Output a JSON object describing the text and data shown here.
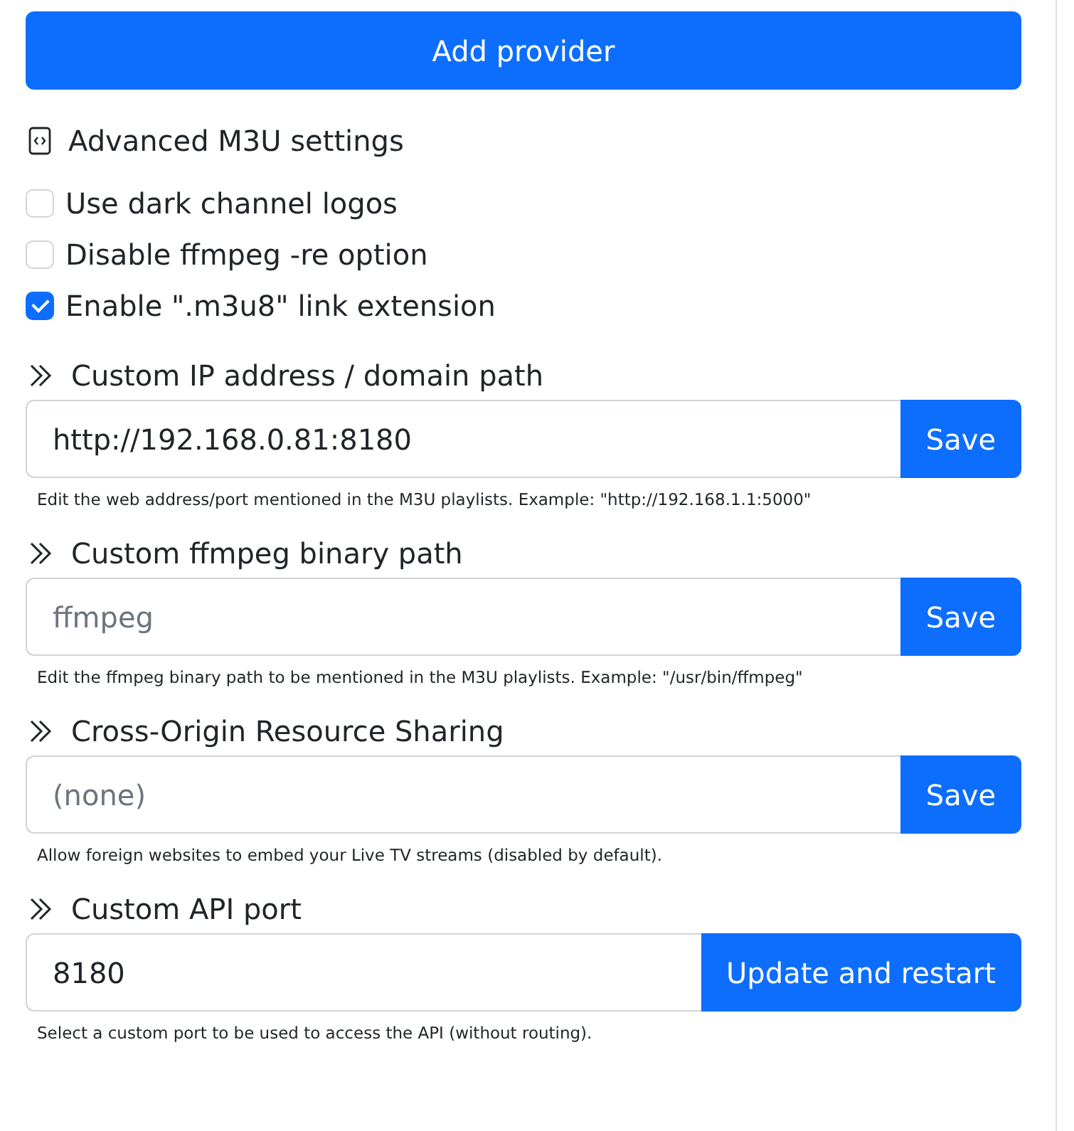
{
  "add_button": "Add provider",
  "advanced": {
    "title": "Advanced M3U settings",
    "options": [
      {
        "label": "Use dark channel logos",
        "checked": false
      },
      {
        "label": "Disable ffmpeg -re option",
        "checked": false
      },
      {
        "label": "Enable \".m3u8\" link extension",
        "checked": true
      }
    ]
  },
  "sections": [
    {
      "title": "Custom IP address / domain path",
      "value": "http://192.168.0.81:8180",
      "button": "Save",
      "help": "Edit the web address/port mentioned in the M3U playlists. Example: \"http://192.168.1.1:5000\""
    },
    {
      "title": "Custom ffmpeg binary path",
      "placeholder": "ffmpeg",
      "button": "Save",
      "help": "Edit the ffmpeg binary path to be mentioned in the M3U playlists. Example: \"/usr/bin/ffmpeg\""
    },
    {
      "title": "Cross-Origin Resource Sharing",
      "placeholder": "(none)",
      "button": "Save",
      "help": "Allow foreign websites to embed your Live TV streams (disabled by default)."
    },
    {
      "title": "Custom API port",
      "value": "8180",
      "button": "Update and restart",
      "help": "Select a custom port to be used to access the API (without routing)."
    }
  ]
}
